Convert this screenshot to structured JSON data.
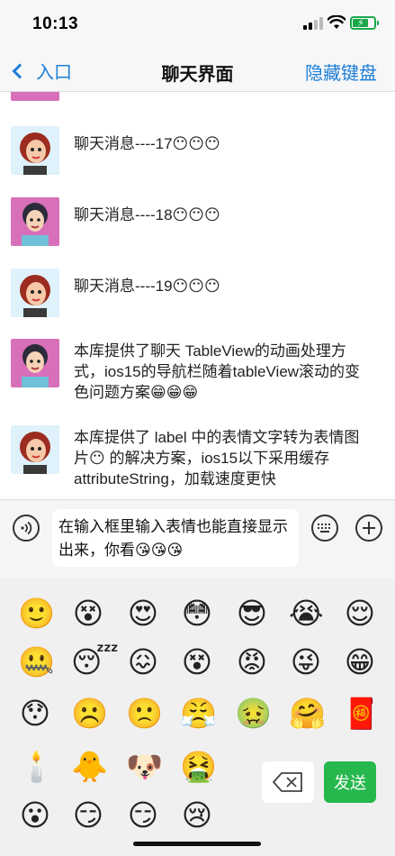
{
  "status_bar": {
    "time": "10:13"
  },
  "nav": {
    "back_label": "入口",
    "title": "聊天界面",
    "right_label": "隐藏键盘"
  },
  "messages": [
    {
      "avatar": "girl-avatar",
      "text": "聊天消息----17😶😶😶"
    },
    {
      "avatar": "boy-avatar",
      "text": "聊天消息----18😶😶😶"
    },
    {
      "avatar": "girl-avatar",
      "text": "聊天消息----19😶😶😶"
    },
    {
      "avatar": "boy-avatar",
      "text": "本库提供了聊天 TableView的动画处理方式，ios15的导航栏随着tableView滚动的变色问题方案😁😁😁"
    },
    {
      "avatar": "girl-avatar",
      "text": "本库提供了 label 中的表情文字转为表情图片😶 的解决方案，ios15以下采用缓存attributeString，加载速度更快"
    }
  ],
  "input": {
    "value": "在输入框里输入表情也能直接显示出来，你看😘😘😘"
  },
  "emoji_rows": [
    [
      "🙂",
      "😵",
      "😍",
      "😳",
      "😎",
      "😭",
      "😌"
    ],
    [
      "🤐",
      "😴",
      "😖",
      "😵",
      "😡",
      "😜",
      "😁"
    ],
    [
      "😯",
      "☹️",
      "🙁",
      "😤",
      "🤢",
      "🤗",
      "🧧"
    ],
    [
      "🕯️",
      "🐥",
      "🐶",
      "🤮",
      "",
      "",
      ""
    ],
    [
      "😮",
      "😏",
      "😏",
      "😢"
    ]
  ],
  "buttons": {
    "send_label": "发送"
  },
  "colors": {
    "accent": "#1e7fd8",
    "send": "#27b84d"
  }
}
